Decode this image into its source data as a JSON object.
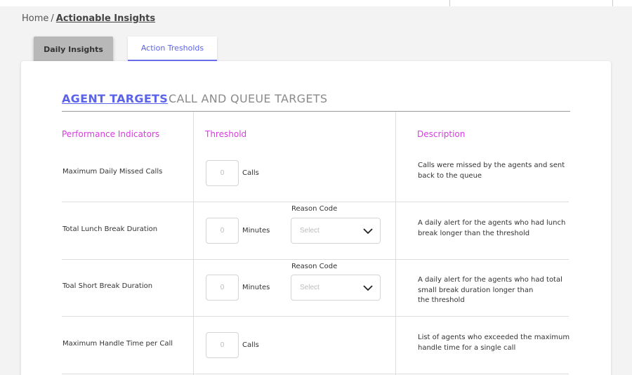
{
  "breadcrumb": {
    "home": "Home",
    "separator": "/",
    "current": "Actionable Insights"
  },
  "tabs": {
    "daily": "Daily Insights",
    "action": "Action Tresholds"
  },
  "sub_tabs": {
    "agent": "AGENT TARGETS",
    "call_queue": "CALL AND QUEUE TARGETS"
  },
  "columns": {
    "indicators": "Performance Indicators",
    "threshold": "Threshold",
    "description": "Description"
  },
  "rows": [
    {
      "indicator": "Maximum Daily Missed Calls",
      "value": "0",
      "unit": "Calls",
      "description": "Calls were missed by the agents and sent\nback to the queue"
    },
    {
      "indicator": "Total Lunch Break Duration",
      "value": "0",
      "unit": "Minutes",
      "reason_label": "Reason Code",
      "select_placeholder": "Select",
      "description": "A daily alert for the agents who had lunch\nbreak longer than the threshold"
    },
    {
      "indicator": "Toal Short Break Duration",
      "value": "0",
      "unit": "Minutes",
      "reason_label": "Reason Code",
      "select_placeholder": "Select",
      "description": "A daily alert for the agents who had total\nsmall break duration longer than\nthe threshold"
    },
    {
      "indicator": "Maximum Handle Time per Call",
      "value": "0",
      "unit": "Calls",
      "description": "List of agents who exceeded the maximum\nhandle time for a single call"
    }
  ],
  "colors": {
    "accent": "#5b63e8",
    "column_header": "#d63ce0"
  },
  "icons": {
    "select_arrow": "chevron-down-icon"
  }
}
